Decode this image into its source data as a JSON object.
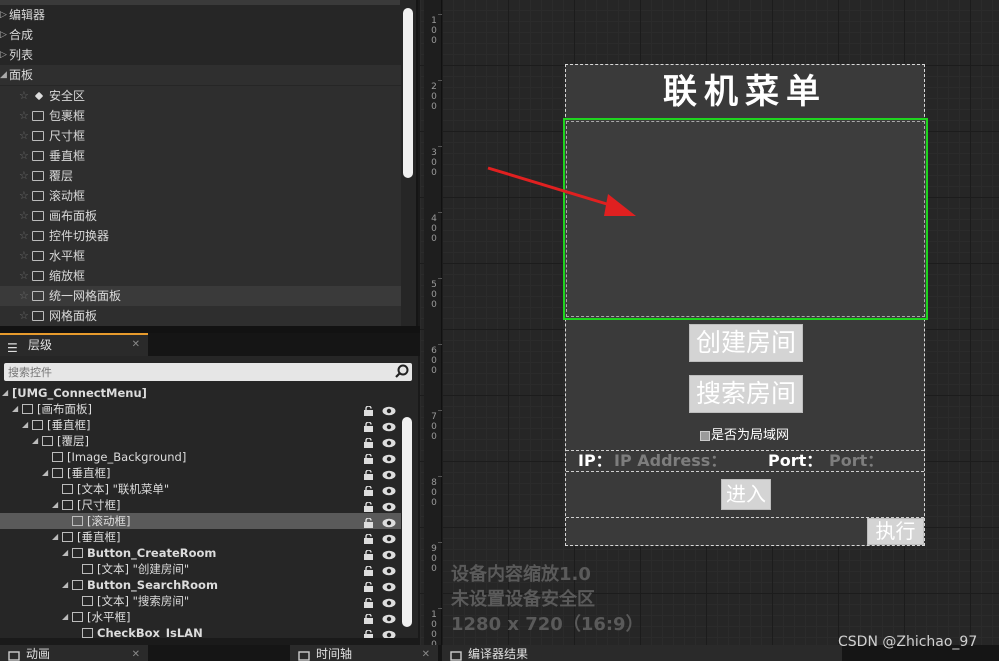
{
  "palette": {
    "categories": [
      {
        "label": "编辑器",
        "expanded": false
      },
      {
        "label": "合成",
        "expanded": false
      },
      {
        "label": "列表",
        "expanded": false
      },
      {
        "label": "面板",
        "expanded": true
      }
    ],
    "items": [
      {
        "label": "安全区",
        "icon": "safe-zone-icon"
      },
      {
        "label": "包裹框",
        "icon": "wrap-box-icon"
      },
      {
        "label": "尺寸框",
        "icon": "size-box-icon"
      },
      {
        "label": "垂直框",
        "icon": "vertical-box-icon"
      },
      {
        "label": "覆层",
        "icon": "overlay-icon"
      },
      {
        "label": "滚动框",
        "icon": "scroll-box-icon"
      },
      {
        "label": "画布面板",
        "icon": "canvas-panel-icon"
      },
      {
        "label": "控件切换器",
        "icon": "widget-switcher-icon"
      },
      {
        "label": "水平框",
        "icon": "horizontal-box-icon"
      },
      {
        "label": "缩放框",
        "icon": "scale-box-icon"
      },
      {
        "label": "统一网格面板",
        "icon": "uniform-grid-icon"
      },
      {
        "label": "网格面板",
        "icon": "grid-panel-icon"
      }
    ]
  },
  "hierarchy": {
    "tab_label": "层级",
    "search_placeholder": "搜索控件",
    "nodes": [
      {
        "label": "[UMG_ConnectMenu]",
        "bold": true
      },
      {
        "label": "[画布面板]",
        "bold": false
      },
      {
        "label": "[垂直框]",
        "bold": false
      },
      {
        "label": "[覆层]",
        "bold": false
      },
      {
        "label": "[Image_Background]",
        "bold": false
      },
      {
        "label": "[垂直框]",
        "bold": false
      },
      {
        "label": "[文本] \"联机菜单\"",
        "bold": false
      },
      {
        "label": "[尺寸框]",
        "bold": false
      },
      {
        "label": "[滚动框]",
        "bold": false,
        "selected": true
      },
      {
        "label": "[垂直框]",
        "bold": false
      },
      {
        "label": "Button_CreateRoom",
        "bold": true
      },
      {
        "label": "[文本] \"创建房间\"",
        "bold": false
      },
      {
        "label": "Button_SearchRoom",
        "bold": true
      },
      {
        "label": "[文本] \"搜索房间\"",
        "bold": false
      },
      {
        "label": "[水平框]",
        "bold": false
      },
      {
        "label": "CheckBox_IsLAN",
        "bold": true
      }
    ]
  },
  "bottom_tabs": [
    {
      "label": "动画",
      "icon": "pencil-icon"
    },
    {
      "label": "时间轴",
      "icon": "timeline-icon"
    },
    {
      "label": "编译器结果",
      "icon": "compiler-icon"
    }
  ],
  "ruler": {
    "labels": [
      "100",
      "200",
      "300",
      "400",
      "500",
      "600",
      "700",
      "800",
      "900",
      "1000"
    ]
  },
  "menu": {
    "title": "联机菜单",
    "create_button": "创建房间",
    "search_button": "搜索房间",
    "lan_label": "是否为局域网",
    "ip_label": "IP：",
    "ip_placeholder": "IP Address：",
    "port_label": "Port：",
    "port_placeholder": "Port：",
    "enter_button": "进入",
    "exec_button": "执行"
  },
  "info": {
    "scale": "设备内容缩放1.0",
    "safe_zone": "未设置设备安全区",
    "resolution": "1280 x 720（16:9）"
  },
  "watermark": "CSDN @Zhichao_97",
  "colors": {
    "selection_outline": "#1fd41f",
    "annotation_arrow": "#e02020",
    "tab_accent": "#e79b2d"
  }
}
